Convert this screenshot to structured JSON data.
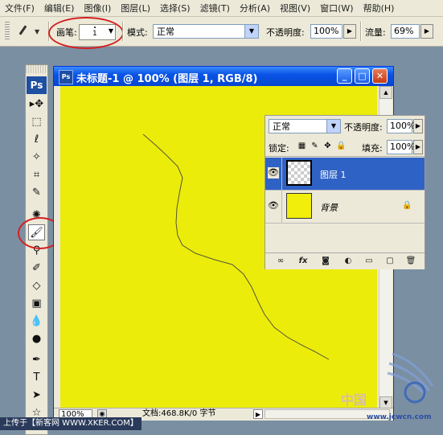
{
  "menubar": {
    "items": [
      "文件(F)",
      "编辑(E)",
      "图像(I)",
      "图层(L)",
      "选择(S)",
      "滤镜(T)",
      "分析(A)",
      "视图(V)",
      "窗口(W)",
      "帮助(H)"
    ]
  },
  "options": {
    "brush_label": "画笔:",
    "brush_size": "1",
    "mode_label": "模式:",
    "mode_value": "正常",
    "opacity_label": "不透明度:",
    "opacity_value": "100%",
    "flow_label": "流量:",
    "flow_value": "69%"
  },
  "tools": {
    "logo": "Ps",
    "items": [
      "move-icon",
      "marquee-icon",
      "lasso-icon",
      "magic-wand-icon",
      "crop-icon",
      "slice-icon",
      "healing-icon",
      "brush-icon",
      "stamp-icon",
      "history-brush-icon",
      "eraser-icon",
      "gradient-icon",
      "blur-icon",
      "dodge-icon",
      "pen-icon",
      "type-icon",
      "path-select-icon",
      "shape-icon"
    ],
    "active": "brush-icon"
  },
  "document": {
    "title": "未标题-1 @ 100% (图层 1, RGB/8)",
    "canvas_color": "#ecec0b",
    "zoom": "100%",
    "info": "文档:468.8K/0 字节"
  },
  "layers_panel": {
    "blend_mode": "正常",
    "opacity_label": "不透明度:",
    "opacity_value": "100%",
    "lock_label": "锁定:",
    "fill_label": "填充:",
    "fill_value": "100%",
    "layers": [
      {
        "name": "图层 1",
        "selected": true,
        "thumbnail": "transparent"
      },
      {
        "name": "背景",
        "selected": false,
        "thumbnail": "yellow",
        "locked": true
      }
    ]
  },
  "footer": {
    "caption": "上传于【新客网 WWW.XKER.COM】",
    "watermark_cn": "中国",
    "watermark_url": "www.jcwcn.com"
  },
  "colors": {
    "accent": "#0a54e6",
    "highlight_oval": "#d42020",
    "selected_layer": "#2f62c5"
  }
}
